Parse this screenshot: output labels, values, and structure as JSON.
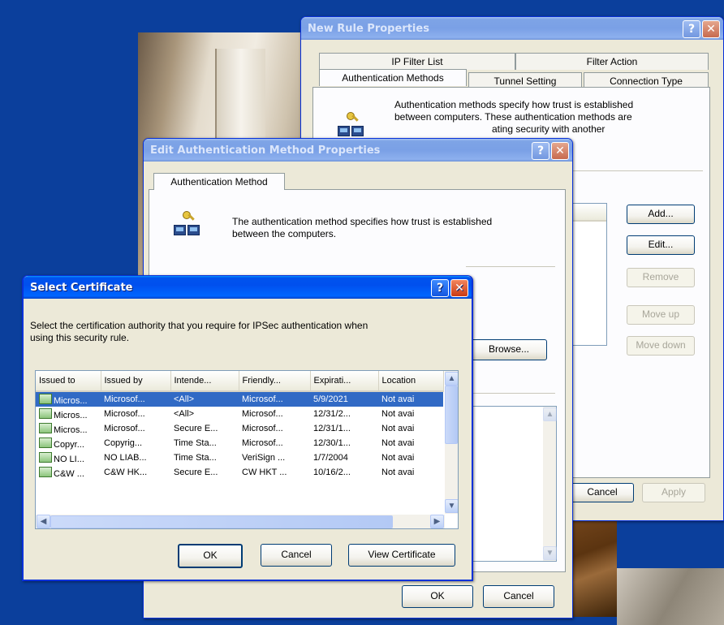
{
  "new_rule": {
    "title": "New Rule Properties",
    "tabs": {
      "ip_filter_list": "IP Filter List",
      "filter_action": "Filter Action",
      "authentication_methods": "Authentication Methods",
      "tunnel_setting": "Tunnel Setting",
      "connection_type": "Connection Type"
    },
    "description_line1": "Authentication methods specify how trust is established",
    "description_line2": "between computers. These authentication methods are",
    "description_line3": "ating security with another",
    "buttons": {
      "add": "Add...",
      "edit": "Edit...",
      "remove": "Remove",
      "move_up": "Move up",
      "move_down": "Move down",
      "cancel": "Cancel",
      "apply": "Apply"
    },
    "help_glyph": "?",
    "close_glyph": "✕"
  },
  "edit_auth": {
    "title": "Edit Authentication Method Properties",
    "tab": "Authentication Method",
    "description_line1": "The authentication method specifies how trust is established",
    "description_line2": "between the computers.",
    "buttons": {
      "browse": "Browse...",
      "ok": "OK",
      "cancel": "Cancel"
    },
    "help_glyph": "?",
    "close_glyph": "✕"
  },
  "select_cert": {
    "title": "Select Certificate",
    "instruction_line1": "Select the certification authority that you require for IPSec authentication when",
    "instruction_line2": "using this security rule.",
    "columns": [
      "Issued to",
      "Issued by",
      "Intende...",
      "Friendly...",
      "Expirati...",
      "Location"
    ],
    "rows": [
      [
        "Micros...",
        "Microsof...",
        "<All>",
        "Microsof...",
        "5/9/2021",
        "Not avai"
      ],
      [
        "Micros...",
        "Microsof...",
        "<All>",
        "Microsof...",
        "12/31/2...",
        "Not avai"
      ],
      [
        "Micros...",
        "Microsof...",
        "Secure E...",
        "Microsof...",
        "12/31/1...",
        "Not avai"
      ],
      [
        "Copyr...",
        "Copyrig...",
        "Time Sta...",
        "Microsof...",
        "12/30/1...",
        "Not avai"
      ],
      [
        "NO LI...",
        "NO LIAB...",
        "Time Sta...",
        "VeriSign ...",
        "1/7/2004",
        "Not avai"
      ],
      [
        "C&W ...",
        "C&W HK...",
        "Secure E...",
        "CW HKT ...",
        "10/16/2...",
        "Not avai"
      ]
    ],
    "selected_row": 0,
    "buttons": {
      "ok": "OK",
      "cancel": "Cancel",
      "view_certificate": "View Certificate"
    },
    "help_glyph": "?",
    "close_glyph": "✕"
  }
}
